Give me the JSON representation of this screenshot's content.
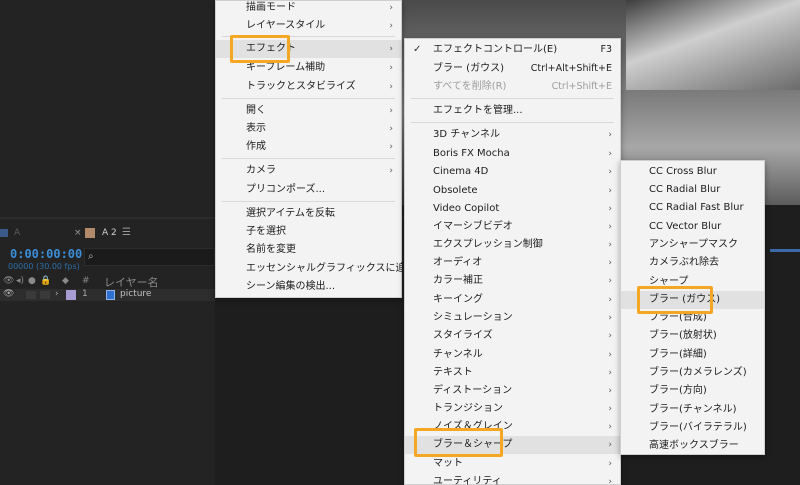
{
  "timeline": {
    "tab_a_label": "A",
    "tab_a2_label": "A 2",
    "timecode": "0:00:00:00",
    "fps": "00000 (30.00 fps)",
    "layer_name_header": "レイヤー名",
    "hash_header": "#",
    "layer_number": "1",
    "layer_name": "picture"
  },
  "menu_layer": {
    "items": [
      {
        "label": "描画モード",
        "submenu": true
      },
      {
        "label": "レイヤースタイル",
        "submenu": true
      },
      {
        "label": "エフェクト",
        "submenu": true,
        "highlighted": true
      },
      {
        "label": "キーフレーム補助",
        "submenu": true
      },
      {
        "label": "トラックとスタビライズ",
        "submenu": true
      },
      {
        "label": "開く",
        "submenu": true
      },
      {
        "label": "表示",
        "submenu": true
      },
      {
        "label": "作成",
        "submenu": true
      },
      {
        "label": "カメラ",
        "submenu": true
      },
      {
        "label": "プリコンポーズ..."
      },
      {
        "label": "選択アイテムを反転"
      },
      {
        "label": "子を選択"
      },
      {
        "label": "名前を変更"
      },
      {
        "label": "エッセンシャルグラフィックスに追加"
      },
      {
        "label": "シーン編集の検出..."
      }
    ]
  },
  "menu_effect": {
    "items": [
      {
        "label": "エフェクトコントロール(E)",
        "shortcut": "F3",
        "checked": true
      },
      {
        "label": "ブラー (ガウス)",
        "shortcut": "Ctrl+Alt+Shift+E"
      },
      {
        "label": "すべてを削除(R)",
        "shortcut": "Ctrl+Shift+E",
        "disabled": true
      },
      {
        "label": "エフェクトを管理..."
      },
      {
        "label": "3D チャンネル",
        "submenu": true
      },
      {
        "label": "Boris FX Mocha",
        "submenu": true
      },
      {
        "label": "Cinema 4D",
        "submenu": true
      },
      {
        "label": "Obsolete",
        "submenu": true
      },
      {
        "label": "Video Copilot",
        "submenu": true
      },
      {
        "label": "イマーシブビデオ",
        "submenu": true
      },
      {
        "label": "エクスプレッション制御",
        "submenu": true
      },
      {
        "label": "オーディオ",
        "submenu": true
      },
      {
        "label": "カラー補正",
        "submenu": true
      },
      {
        "label": "キーイング",
        "submenu": true
      },
      {
        "label": "シミュレーション",
        "submenu": true
      },
      {
        "label": "スタイライズ",
        "submenu": true
      },
      {
        "label": "チャンネル",
        "submenu": true
      },
      {
        "label": "テキスト",
        "submenu": true
      },
      {
        "label": "ディストーション",
        "submenu": true
      },
      {
        "label": "トランジション",
        "submenu": true
      },
      {
        "label": "ノイズ＆グレイン",
        "submenu": true
      },
      {
        "label": "ブラー＆シャープ",
        "submenu": true,
        "highlighted": true
      },
      {
        "label": "マット",
        "submenu": true
      },
      {
        "label": "ユーティリティ",
        "submenu": true
      }
    ]
  },
  "menu_blur": {
    "items": [
      {
        "label": "CC Cross Blur"
      },
      {
        "label": "CC Radial Blur"
      },
      {
        "label": "CC Radial Fast Blur"
      },
      {
        "label": "CC Vector Blur"
      },
      {
        "label": "アンシャープマスク"
      },
      {
        "label": "カメラぶれ除去"
      },
      {
        "label": "シャープ"
      },
      {
        "label": "ブラー (ガウス)",
        "highlighted": true
      },
      {
        "label": "ブラー(合成)"
      },
      {
        "label": "ブラー(放射状)"
      },
      {
        "label": "ブラー(詳細)"
      },
      {
        "label": "ブラー(カメラレンズ)"
      },
      {
        "label": "ブラー(方向)"
      },
      {
        "label": "ブラー(チャンネル)"
      },
      {
        "label": "ブラー(バイラテラル)"
      },
      {
        "label": "高速ボックスブラー"
      }
    ]
  },
  "colors": {
    "highlight_box": "#f5a623",
    "timecode": "#3a8ed8"
  }
}
